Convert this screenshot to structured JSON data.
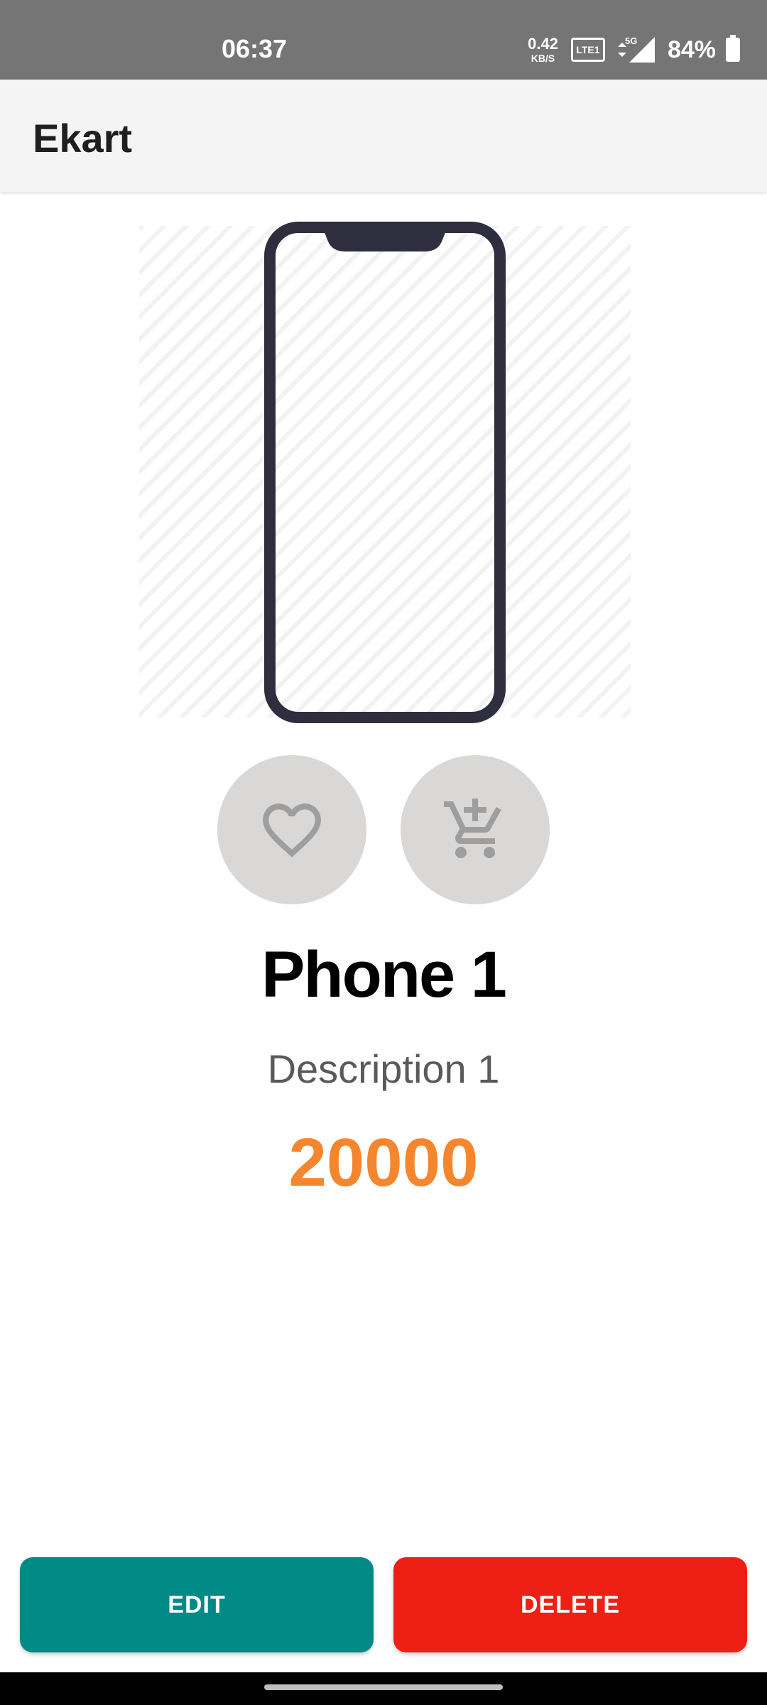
{
  "status_bar": {
    "time": "06:37",
    "net_speed_value": "0.42",
    "net_speed_unit": "KB/S",
    "volte_label": "Vo LTE 1",
    "network": "5G",
    "battery": "84%"
  },
  "app_bar": {
    "title": "Ekart"
  },
  "product": {
    "name": "Phone 1",
    "description": "Description 1",
    "price": "20000",
    "price_color": "#f5862e"
  },
  "actions": {
    "favorite_icon": "heart-outline-icon",
    "cart_icon": "add-shopping-cart-icon"
  },
  "buttons": {
    "edit_label": "EDIT",
    "delete_label": "DELETE",
    "edit_color": "#008a85",
    "delete_color": "#ee1f14"
  }
}
